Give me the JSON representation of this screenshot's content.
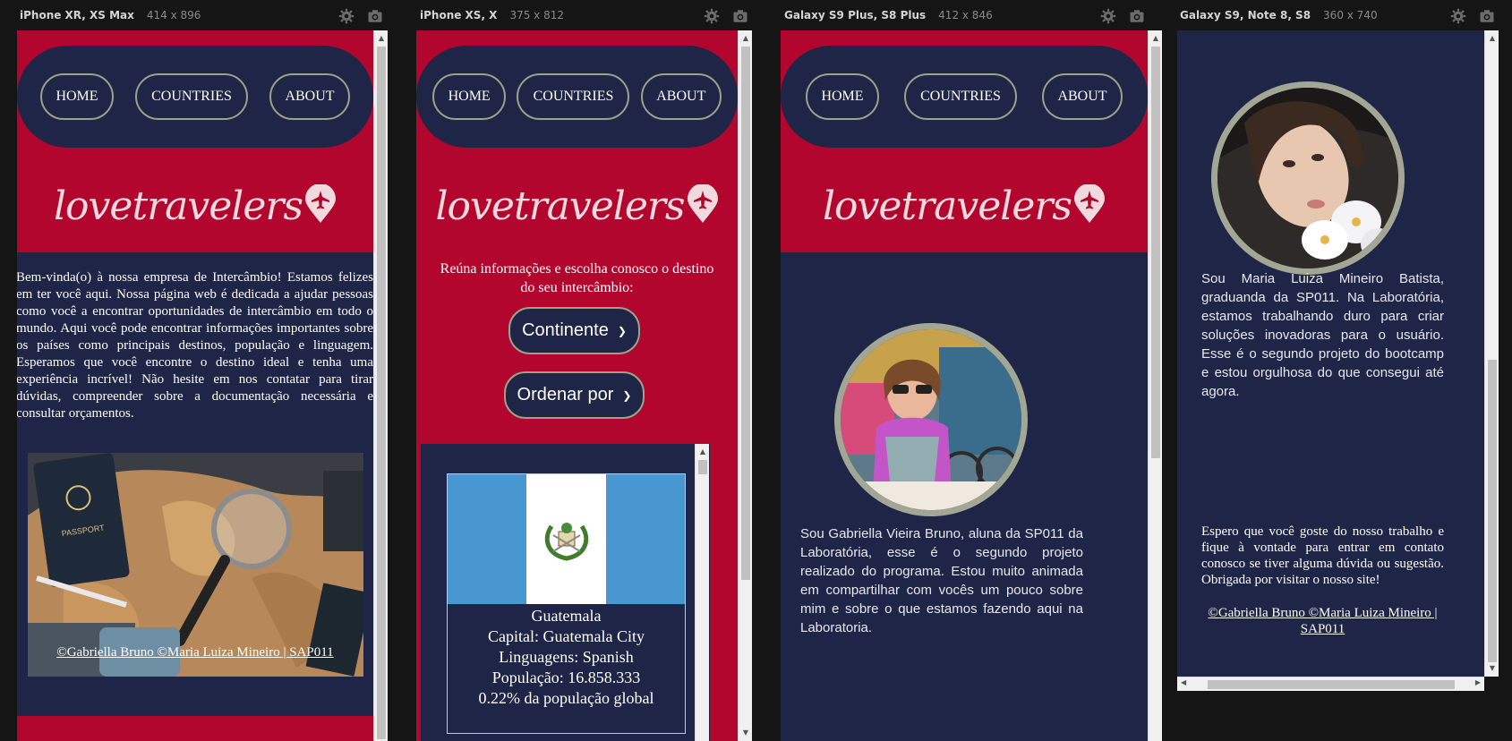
{
  "devices": [
    {
      "name": "iPhone XR, XS Max",
      "size": "414 x 896"
    },
    {
      "name": "iPhone XS, X",
      "size": "375 x 812"
    },
    {
      "name": "Galaxy S9 Plus, S8 Plus",
      "size": "412 x 846"
    },
    {
      "name": "Galaxy S9, Note 8, S8",
      "size": "360 x 740"
    }
  ],
  "nav": {
    "home": "HOME",
    "countries": "COUNTRIES",
    "about": "ABOUT"
  },
  "logo": {
    "text": "lovetravelers"
  },
  "home": {
    "intro": "Bem-vinda(o) à nossa empresa de Intercâmbio! Estamos felizes em ter você aqui. Nossa página web é dedicada a ajudar pessoas como você a encontrar oportunidades de intercâmbio em todo o mundo. Aqui você pode encontrar informações importantes sobre os países como principais destinos, população e linguagem. Esperamos que você encontre o destino ideal e tenha uma experiência incrível! Não hesite em nos contatar para tirar dúvidas, compreender sobre a documentação necessária e consultar orçamentos.",
    "footer": "©Gabriella Bruno ©Maria Luiza Mineiro | SAP011"
  },
  "countries": {
    "prompt": "Reúna informações e escolha conosco o destino do seu intercâmbio:",
    "continent_select": "Continente",
    "order_select": "Ordenar por",
    "card": {
      "name": "Guatemala",
      "capital": "Capital: Guatemala City",
      "languages": "Linguagens: Spanish",
      "population": "População: 16.858.333",
      "global_share": "0.22% da população global"
    }
  },
  "about1": {
    "bio": "Sou Gabriella Vieira Bruno, aluna da SP011 da Laboratória, esse é o segundo projeto realizado do programa. Estou muito animada em compartilhar com vocês um pouco sobre mim e sobre o que estamos fazendo aqui na Laboratoria."
  },
  "about2": {
    "bio": "Sou Maria Luiza Mineiro Batista, graduanda da SP011. Na Laboratória, estamos trabalhando duro para criar soluções inovadoras para o usuário. Esse é o segundo projeto do bootcamp e estou orgulhosa do que consegui até agora.",
    "closing": "Espero que você goste do nosso trabalho e fique à vontade para entrar em contato conosco se tiver alguma dúvida ou sugestão. Obrigada por visitar o nosso site!",
    "footer": "©Gabriella Bruno ©Maria Luiza Mineiro | SAP011"
  },
  "colors": {
    "brand_red": "#b3062e",
    "navy": "#1e2546",
    "border": "#9aa28a",
    "flag_blue": "#4997d0"
  },
  "icons": [
    "settings-icon",
    "camera-icon",
    "plane-pin-icon",
    "chevron-down-icon"
  ]
}
